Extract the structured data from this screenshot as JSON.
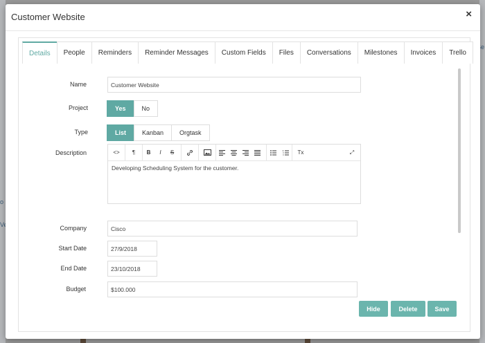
{
  "modal": {
    "title": "Customer Website",
    "close_label": "×"
  },
  "background": {
    "right_text": "Se",
    "left_texts": [
      "o",
      "Ve"
    ]
  },
  "tabs": [
    {
      "label": "Details",
      "active": true
    },
    {
      "label": "People",
      "active": false
    },
    {
      "label": "Reminders",
      "active": false
    },
    {
      "label": "Reminder Messages",
      "active": false
    },
    {
      "label": "Custom Fields",
      "active": false
    },
    {
      "label": "Files",
      "active": false
    },
    {
      "label": "Conversations",
      "active": false
    },
    {
      "label": "Milestones",
      "active": false
    },
    {
      "label": "Invoices",
      "active": false
    },
    {
      "label": "Trello",
      "active": false
    }
  ],
  "form": {
    "name_label": "Name",
    "name_value": "Customer Website",
    "project_label": "Project",
    "project_options": [
      "Yes",
      "No"
    ],
    "project_selected": "Yes",
    "type_label": "Type",
    "type_options": [
      "List",
      "Kanban",
      "Orgtask"
    ],
    "type_selected": "List",
    "description_label": "Description",
    "description_value": "Developing Scheduling System for the customer.",
    "company_label": "Company",
    "company_value": "Cisco",
    "start_date_label": "Start Date",
    "start_date_value": "27/9/2018",
    "end_date_label": "End Date",
    "end_date_value": "23/10/2018",
    "budget_label": "Budget",
    "budget_value": "$100.000"
  },
  "toolbar": {
    "code": "<>",
    "paragraph": "¶",
    "bold": "B",
    "italic": "I",
    "strike": "S",
    "link": "🔗",
    "image": "🖼",
    "align_left": "≡",
    "align_center": "≡",
    "align_right": "≡",
    "justify": "≡",
    "bullet_list": "☰",
    "number_list": "☰",
    "clear_format": "Tx",
    "fullscreen": "⤢"
  },
  "actions": {
    "hide": "Hide",
    "delete": "Delete",
    "save": "Save"
  },
  "colors": {
    "accent": "#5fa9a3",
    "button": "#6bb5ad"
  }
}
